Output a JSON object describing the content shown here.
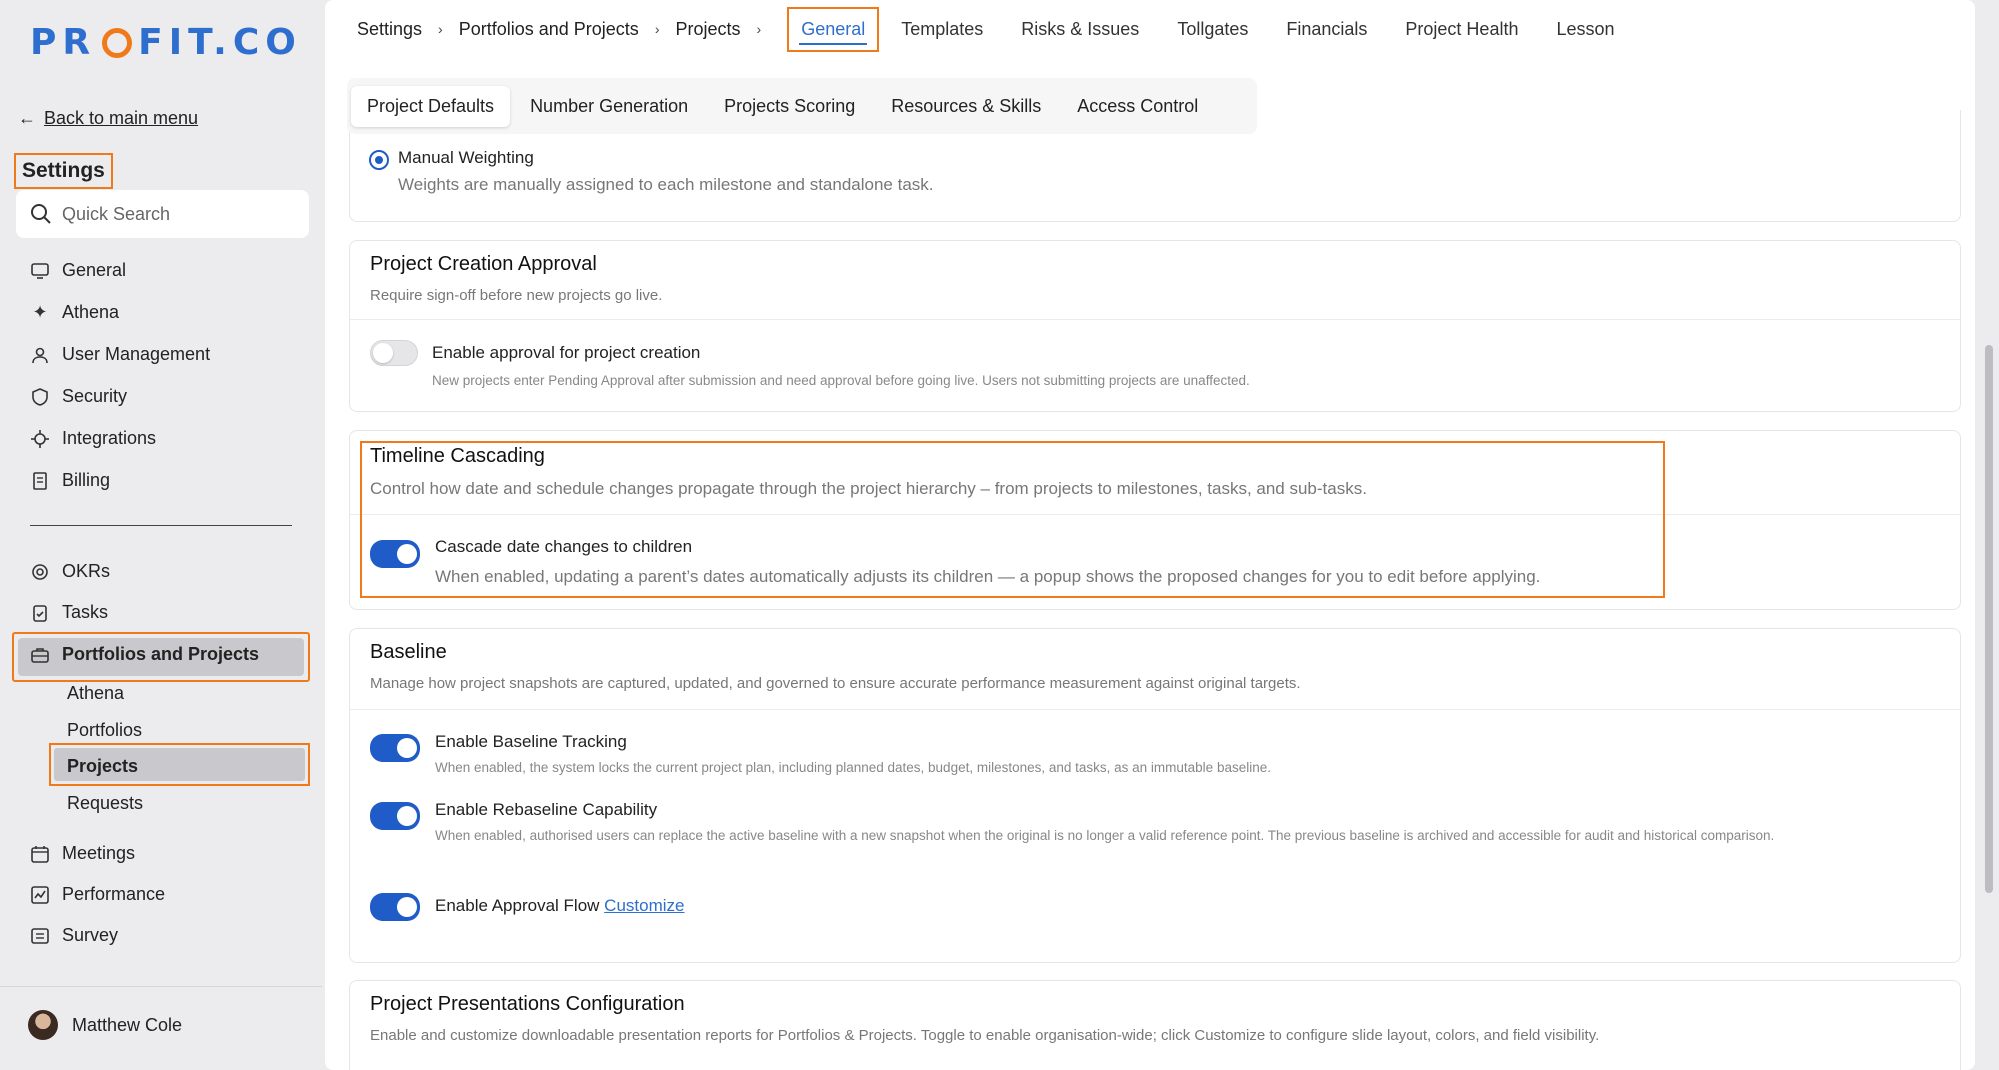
{
  "brand": {
    "logo_left": "PR",
    "logo_right": "FIT.CO",
    "accent": "#2d6ecf",
    "highlight": "#f07a1a"
  },
  "sidebar": {
    "back_label": "Back to main menu",
    "title": "Settings",
    "search_placeholder": "Quick Search",
    "items_top": [
      {
        "label": "General",
        "icon": "monitor-icon"
      },
      {
        "label": "Athena",
        "icon": "sparkle-icon"
      },
      {
        "label": "User Management",
        "icon": "user-icon"
      },
      {
        "label": "Security",
        "icon": "shield-icon"
      },
      {
        "label": "Integrations",
        "icon": "puzzle-icon"
      },
      {
        "label": "Billing",
        "icon": "receipt-icon"
      }
    ],
    "items_bottom": [
      {
        "label": "OKRs",
        "icon": "target-icon"
      },
      {
        "label": "Tasks",
        "icon": "clipboard-icon"
      },
      {
        "label": "Portfolios and Projects",
        "icon": "briefcase-icon"
      }
    ],
    "sub_items": [
      "Athena",
      "Portfolios",
      "Projects",
      "Requests"
    ],
    "items_tail": [
      {
        "label": "Meetings",
        "icon": "calendar-icon"
      },
      {
        "label": "Performance",
        "icon": "chart-icon"
      },
      {
        "label": "Survey",
        "icon": "survey-icon"
      }
    ],
    "user_name": "Matthew Cole"
  },
  "topbar": {
    "crumbs": [
      "Settings",
      "Portfolios and Projects",
      "Projects"
    ],
    "tabs": [
      "General",
      "Templates",
      "Risks & Issues",
      "Tollgates",
      "Financials",
      "Project Health",
      "Lesson"
    ]
  },
  "subtabs": [
    "Project Defaults",
    "Number Generation",
    "Projects Scoring",
    "Resources & Skills",
    "Access Control"
  ],
  "weighting": {
    "label": "Manual Weighting",
    "desc": "Weights are manually assigned to each milestone and standalone task."
  },
  "creation_approval": {
    "title": "Project Creation Approval",
    "desc": "Require sign-off before new projects go live.",
    "option_label": "Enable approval for project creation",
    "option_desc": "New projects enter Pending Approval after submission and need approval before going live. Users not submitting projects are unaffected."
  },
  "timeline": {
    "title": "Timeline Cascading",
    "desc": "Control how date and schedule changes propagate through the project hierarchy – from projects to milestones, tasks, and sub-tasks.",
    "option_label": "Cascade date changes to children",
    "option_desc": "When enabled, updating a parent’s dates automatically adjusts its children — a popup shows the proposed changes for you to edit before applying."
  },
  "baseline": {
    "title": "Baseline",
    "desc": "Manage how project snapshots are captured, updated, and governed to ensure accurate performance measurement against original targets.",
    "tracking_label": "Enable Baseline Tracking",
    "tracking_desc": "When enabled, the system locks the current project plan, including planned dates, budget, milestones, and tasks, as an immutable baseline.",
    "rebaseline_label": "Enable Rebaseline Capability",
    "rebaseline_desc": "When enabled, authorised users can replace the active baseline with a new snapshot when the original is no longer a valid reference point. The previous baseline is archived and accessible for audit and historical comparison.",
    "approval_label": "Enable Approval Flow",
    "approval_link": "Customize"
  },
  "presentations": {
    "title": "Project Presentations Configuration",
    "desc": "Enable and customize downloadable presentation reports for Portfolios & Projects. Toggle to enable organisation-wide; click Customize to configure slide layout, colors, and field visibility."
  }
}
